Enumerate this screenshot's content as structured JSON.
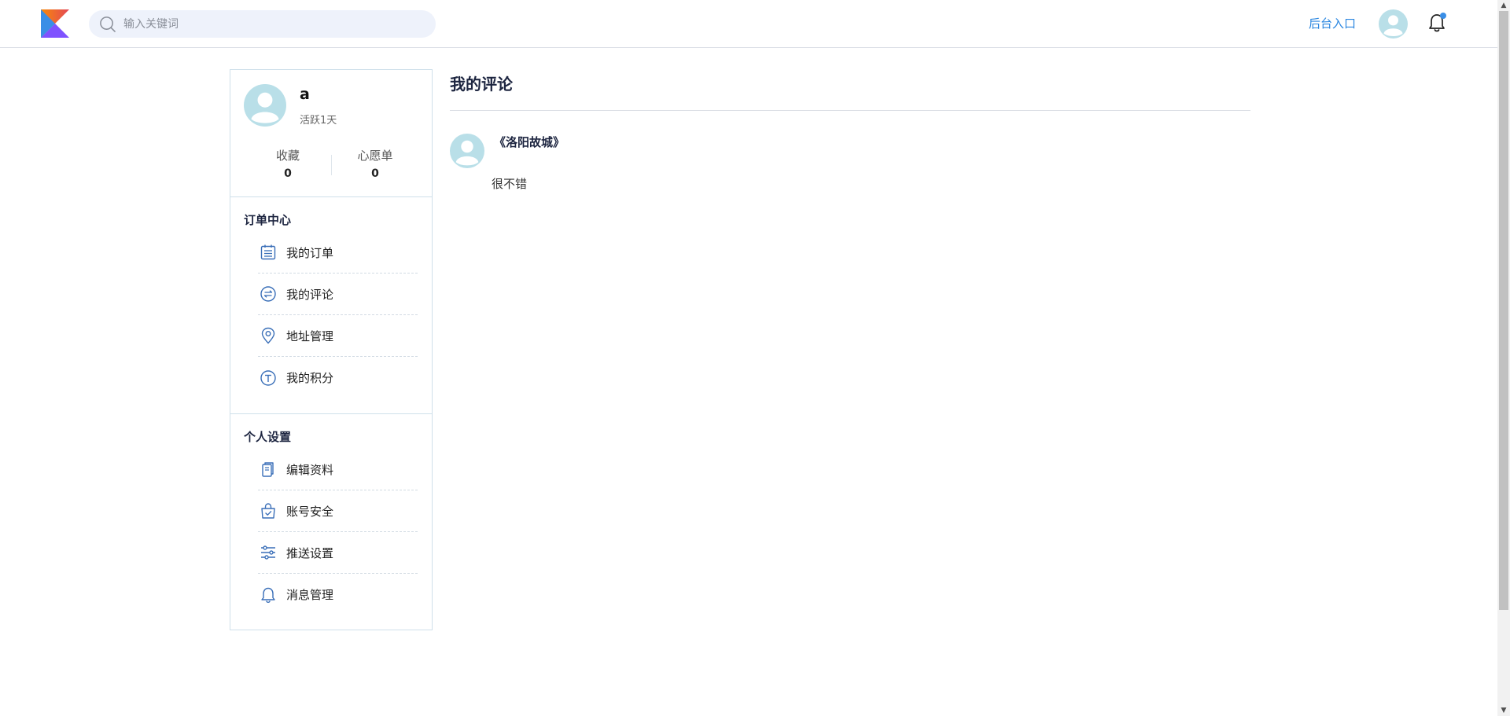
{
  "header": {
    "search_placeholder": "输入关键词",
    "admin_link": "后台入口"
  },
  "colors": {
    "accent": "#2a86e0",
    "avatar_bg": "#b9dfe8",
    "sidebar_border": "#cfe0ea",
    "heading": "#1d2540"
  },
  "profile": {
    "username": "a",
    "active_days": "活跃1天",
    "favorites_label": "收藏",
    "favorites_count": "0",
    "wishlist_label": "心愿单",
    "wishlist_count": "0"
  },
  "sidebar": {
    "orders_title": "订单中心",
    "orders_items": [
      {
        "label": "我的订单",
        "icon": "order-list-icon"
      },
      {
        "label": "我的评论",
        "icon": "comment-icon"
      },
      {
        "label": "地址管理",
        "icon": "location-pin-icon"
      },
      {
        "label": "我的积分",
        "icon": "points-icon"
      }
    ],
    "settings_title": "个人设置",
    "settings_items": [
      {
        "label": "编辑资料",
        "icon": "documents-icon"
      },
      {
        "label": "账号安全",
        "icon": "secure-bag-icon"
      },
      {
        "label": "推送设置",
        "icon": "sliders-icon"
      },
      {
        "label": "消息管理",
        "icon": "bell-icon"
      }
    ]
  },
  "main": {
    "title": "我的评论",
    "comments": [
      {
        "title": "《洛阳故城》",
        "text": "很不错"
      }
    ]
  }
}
